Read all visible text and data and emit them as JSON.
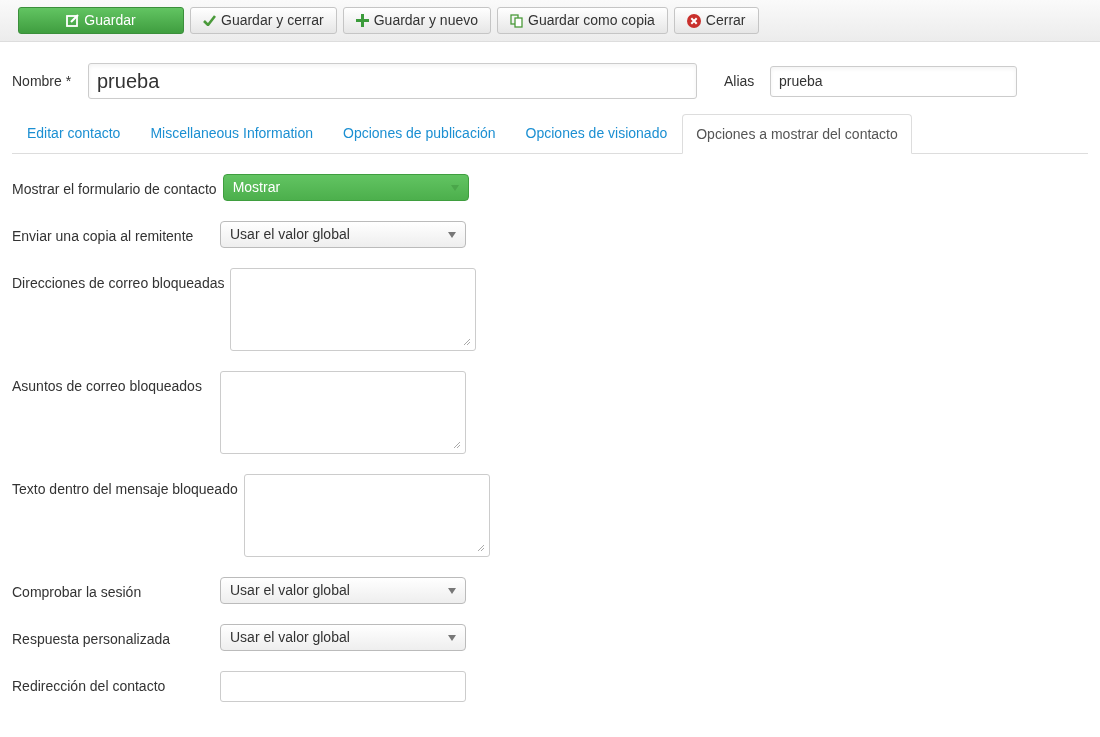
{
  "toolbar": [
    {
      "label": "Guardar",
      "kind": "primary"
    },
    {
      "label": "Guardar y cerrar",
      "kind": "default"
    },
    {
      "label": "Guardar y nuevo",
      "kind": "default"
    },
    {
      "label": "Guardar como copia",
      "kind": "default"
    },
    {
      "label": "Cerrar",
      "kind": "default"
    }
  ],
  "name": {
    "label": "Nombre *",
    "value": "prueba"
  },
  "alias": {
    "label": "Alias",
    "value": "prueba"
  },
  "tabs": [
    {
      "label": "Editar contacto",
      "selected": false
    },
    {
      "label": "Miscellaneous Information",
      "selected": false
    },
    {
      "label": "Opciones de publicación",
      "selected": false
    },
    {
      "label": "Opciones de visionado",
      "selected": false
    },
    {
      "label": "Opciones a mostrar del contacto",
      "selected": true
    }
  ],
  "fields": [
    {
      "label": "Mostrar el formulario de contacto",
      "kind": "active",
      "value": "Mostrar"
    },
    {
      "label": "Enviar una copia al remitente",
      "kind": "select",
      "value": "Usar el valor global"
    },
    {
      "label": "Direcciones de correo bloqueadas",
      "kind": "textarea"
    },
    {
      "label": "Asuntos de correo bloqueados",
      "kind": "textarea"
    },
    {
      "label": "Texto dentro del mensaje bloqueado",
      "kind": "textarea"
    },
    {
      "label": "Comprobar la sesión",
      "kind": "select",
      "value": "Usar el valor global"
    },
    {
      "label": "Respuesta personalizada",
      "kind": "select",
      "value": "Usar el valor global"
    },
    {
      "label": "Redirección del contacto",
      "kind": "text"
    }
  ]
}
